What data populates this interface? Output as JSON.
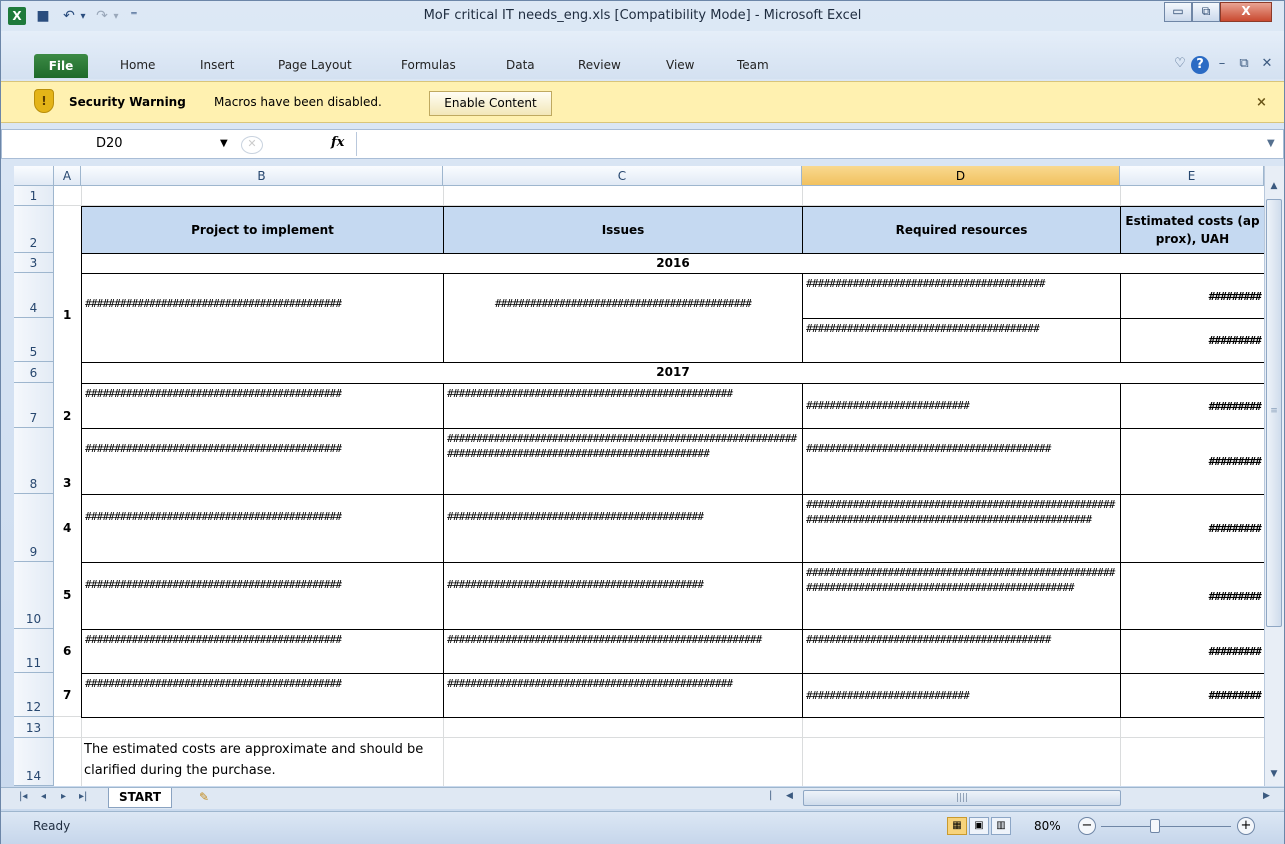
{
  "window": {
    "title": "MoF critical IT needs_eng.xls  [Compatibility Mode]  -  Microsoft Excel",
    "minimize": "▭",
    "restore": "⧉",
    "close": "X"
  },
  "quick_access": {
    "app_icon": "X",
    "save_icon": "■",
    "undo_icon": "↶",
    "undo_drop": "▾",
    "redo_icon": "↷",
    "redo_drop": "▾",
    "customize_icon": "⁼"
  },
  "ribbon": {
    "file_tab": "File",
    "tabs": [
      "Home",
      "Insert",
      "Page Layout",
      "Formulas",
      "Data",
      "Review",
      "View",
      "Team"
    ],
    "right_icons": {
      "favorite": "♡",
      "help": "?",
      "minimize": "–",
      "restore": "⧉",
      "close": "✕"
    }
  },
  "security_bar": {
    "icon": "!",
    "title": "Security Warning",
    "message": "Macros have been disabled.",
    "button": "Enable Content",
    "close": "×"
  },
  "formula_bar": {
    "name_box": "D20",
    "name_arrow": "▼",
    "cancel_glyph": "✕",
    "fx": "fx",
    "expand": "▼",
    "formula": ""
  },
  "columns": [
    "A",
    "B",
    "C",
    "D",
    "E"
  ],
  "rows": [
    "1",
    "2",
    "3",
    "4",
    "5",
    "6",
    "7",
    "8",
    "9",
    "10",
    "11",
    "12",
    "13",
    "14"
  ],
  "table": {
    "headers": {
      "project": "Project to implement",
      "issues": "Issues",
      "resources": "Required resources",
      "costs": "Estimated costs (approx), UAH"
    },
    "year_2016": "2016",
    "year_2017": "2017",
    "entries": [
      {
        "idx": "1",
        "project": "############################################",
        "issues": "############################################",
        "resources_a": "#########################################",
        "resources_b": "########################################",
        "cost_a": "#########",
        "cost_b": "#########"
      },
      {
        "idx": "2",
        "project": "############################################",
        "issues": "#################################################",
        "resources": "############################",
        "cost": "#########"
      },
      {
        "idx": "3",
        "project": "############################################",
        "issues": "#########################################################################################################",
        "resources": "##########################################",
        "cost": "#########"
      },
      {
        "idx": "4",
        "project": "############################################",
        "issues": "############################################",
        "resources": "######################################################################################################",
        "cost": "#########"
      },
      {
        "idx": "5",
        "project": "############################################",
        "issues": "############################################",
        "resources": "###################################################################################################",
        "cost": "#########"
      },
      {
        "idx": "6",
        "project": "############################################",
        "issues": "######################################################",
        "resources": "##########################################",
        "cost": "#########"
      },
      {
        "idx": "7",
        "project": "############################################",
        "issues": "#################################################",
        "resources": "############################",
        "cost": "#########"
      }
    ],
    "note": "The estimated costs are approximate and should be clarified during the purchase."
  },
  "sheet_tabs": {
    "nav": [
      "|◂",
      "◂",
      "▸",
      "▸|"
    ],
    "active": "START",
    "insert_icon": "✎"
  },
  "status_bar": {
    "status": "Ready",
    "zoom": "80%",
    "zoom_out": "−",
    "zoom_in": "+",
    "view_normal": "▦",
    "view_layout": "▣",
    "view_break": "▥"
  },
  "scroll": {
    "up": "▲",
    "down": "▼",
    "left": "◀",
    "right": "▶",
    "grip": "||||",
    "split_v": "≡",
    "split_h": "|"
  }
}
